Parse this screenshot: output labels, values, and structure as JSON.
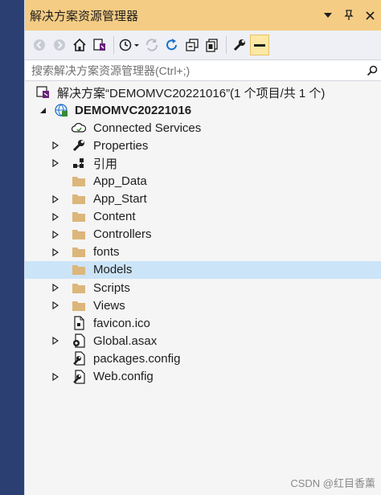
{
  "window": {
    "title": "解决方案资源管理器",
    "pin_glyph": "📌",
    "close_glyph": "✕"
  },
  "search": {
    "placeholder": "搜索解决方案资源管理器(Ctrl+;)"
  },
  "tree": {
    "solution": "解决方案“DEMOMVC20221016”(1 个项目/共 1 个)",
    "project": "DEMOMVC20221016",
    "items": [
      {
        "label": "Connected Services",
        "icon": "cloud-icon",
        "expandable": false
      },
      {
        "label": "Properties",
        "icon": "wrench-icon",
        "expandable": true
      },
      {
        "label": "引用",
        "icon": "references-icon",
        "expandable": true
      },
      {
        "label": "App_Data",
        "icon": "folder-icon",
        "expandable": false
      },
      {
        "label": "App_Start",
        "icon": "folder-icon",
        "expandable": true
      },
      {
        "label": "Content",
        "icon": "folder-icon",
        "expandable": true
      },
      {
        "label": "Controllers",
        "icon": "folder-icon",
        "expandable": true
      },
      {
        "label": "fonts",
        "icon": "folder-icon",
        "expandable": true
      },
      {
        "label": "Models",
        "icon": "folder-icon",
        "expandable": false,
        "selected": true
      },
      {
        "label": "Scripts",
        "icon": "folder-icon",
        "expandable": true
      },
      {
        "label": "Views",
        "icon": "folder-icon",
        "expandable": true
      },
      {
        "label": "favicon.ico",
        "icon": "file-icon",
        "expandable": false
      },
      {
        "label": "Global.asax",
        "icon": "gear-file-icon",
        "expandable": true
      },
      {
        "label": "packages.config",
        "icon": "config-file-icon",
        "expandable": false
      },
      {
        "label": "Web.config",
        "icon": "config-file-icon",
        "expandable": true
      }
    ]
  },
  "watermark": "CSDN @红目香薰",
  "colors": {
    "title_bar": "#f5cc84",
    "selected_row": "#cce4f7",
    "folder": "#dcb67a"
  }
}
